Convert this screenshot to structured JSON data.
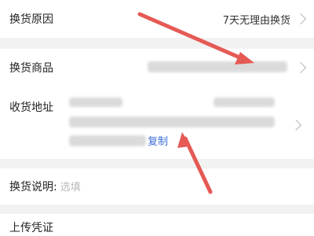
{
  "rows": {
    "reason": {
      "label": "换货原因",
      "value": "7天无理由换货"
    },
    "product": {
      "label": "换货商品"
    },
    "address": {
      "label": "收货地址",
      "copy_label": "复制"
    },
    "note": {
      "label": "换货说明:",
      "placeholder": "选填"
    },
    "upload": {
      "label": "上传凭证"
    }
  },
  "colors": {
    "accent_link": "#3b6fd6",
    "annotation_arrow": "#e55a55"
  }
}
